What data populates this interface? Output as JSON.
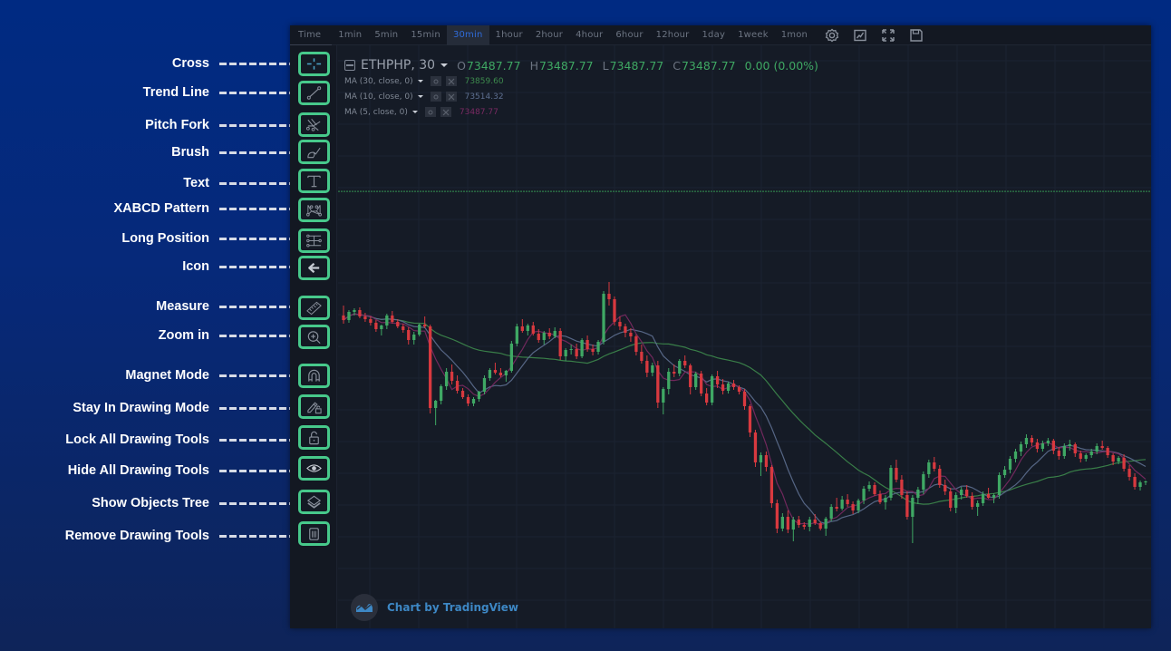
{
  "timeframes": [
    {
      "label": "Time",
      "active": false
    },
    {
      "label": "1min",
      "active": false
    },
    {
      "label": "5min",
      "active": false
    },
    {
      "label": "15min",
      "active": false
    },
    {
      "label": "30min",
      "active": true
    },
    {
      "label": "1hour",
      "active": false
    },
    {
      "label": "2hour",
      "active": false
    },
    {
      "label": "4hour",
      "active": false
    },
    {
      "label": "6hour",
      "active": false
    },
    {
      "label": "12hour",
      "active": false
    },
    {
      "label": "1day",
      "active": false
    },
    {
      "label": "1week",
      "active": false
    },
    {
      "label": "1mon",
      "active": false
    }
  ],
  "topbar_icons": [
    "settings-icon",
    "indicators-icon",
    "fullscreen-icon",
    "save-icon"
  ],
  "legend": {
    "symbol": "ETHPHP, 30",
    "open_label": "O",
    "open": "73487.77",
    "high_label": "H",
    "high": "73487.77",
    "low_label": "L",
    "low": "73487.77",
    "close_label": "C",
    "close": "73487.77",
    "change": "0.00 (0.00%)",
    "ma": [
      {
        "label": "MA (30, close, 0)",
        "value": "73859.60",
        "color": "#3d8a4d"
      },
      {
        "label": "MA (10, close, 0)",
        "value": "73514.32",
        "color": "#5d6f90"
      },
      {
        "label": "MA (5, close, 0)",
        "value": "73487.77",
        "color": "#7b2a63"
      }
    ]
  },
  "tools": [
    {
      "label": "Cross",
      "icon": "cross-icon"
    },
    {
      "label": "Trend Line",
      "icon": "trend-line-icon"
    },
    {
      "label": "Pitch Fork",
      "icon": "pitchfork-icon"
    },
    {
      "label": "Brush",
      "icon": "brush-icon"
    },
    {
      "label": "Text",
      "icon": "text-icon"
    },
    {
      "label": "XABCD Pattern",
      "icon": "xabcd-pattern-icon"
    },
    {
      "label": "Long Position",
      "icon": "long-position-icon"
    },
    {
      "label": "Icon",
      "icon": "arrow-left-icon"
    },
    {
      "label": "Measure",
      "icon": "ruler-icon"
    },
    {
      "label": "Zoom in",
      "icon": "zoom-in-icon"
    },
    {
      "label": "Magnet Mode",
      "icon": "magnet-icon"
    },
    {
      "label": "Stay In Drawing Mode",
      "icon": "pencil-lock-icon"
    },
    {
      "label": "Lock All Drawing Tools",
      "icon": "lock-icon"
    },
    {
      "label": "Hide All Drawing Tools",
      "icon": "eye-icon"
    },
    {
      "label": "Show Objects Tree",
      "icon": "layers-icon"
    },
    {
      "label": "Remove Drawing Tools",
      "icon": "trash-icon"
    }
  ],
  "watermark": "Chart by TradingView",
  "colors": {
    "up": "#3fa864",
    "down": "#d8393f",
    "highlight": "#47c98b",
    "active_tf": "#2f6bd9",
    "price_line": "#2e7d4a"
  },
  "chart_data": {
    "type": "candlestick",
    "symbol": "ETHPHP",
    "interval": "30min",
    "last_price": 73487.77,
    "ylim": [
      72530,
      73790
    ],
    "ohlc": [
      [
        73214,
        73236,
        73196,
        73204
      ],
      [
        73204,
        73226,
        73198,
        73222
      ],
      [
        73222,
        73230,
        73214,
        73226
      ],
      [
        73226,
        73232,
        73208,
        73212
      ],
      [
        73212,
        73220,
        73200,
        73206
      ],
      [
        73206,
        73212,
        73192,
        73198
      ],
      [
        73198,
        73204,
        73178,
        73184
      ],
      [
        73184,
        73194,
        73170,
        73192
      ],
      [
        73192,
        73218,
        73184,
        73214
      ],
      [
        73214,
        73224,
        73196,
        73200
      ],
      [
        73200,
        73206,
        73186,
        73190
      ],
      [
        73190,
        73196,
        73176,
        73182
      ],
      [
        73182,
        73188,
        73150,
        73160
      ],
      [
        73160,
        73178,
        73150,
        73172
      ],
      [
        73172,
        73196,
        73168,
        73194
      ],
      [
        73194,
        73212,
        73186,
        73190
      ],
      [
        73190,
        73194,
        72998,
        73010
      ],
      [
        73010,
        73028,
        72972,
        73026
      ],
      [
        73026,
        73062,
        73018,
        73058
      ],
      [
        73058,
        73098,
        73050,
        73090
      ],
      [
        73090,
        73106,
        73062,
        73070
      ],
      [
        73070,
        73082,
        73042,
        73048
      ],
      [
        73048,
        73054,
        73030,
        73034
      ],
      [
        73034,
        73040,
        73014,
        73020
      ],
      [
        73020,
        73034,
        73014,
        73030
      ],
      [
        73030,
        73048,
        73024,
        73046
      ],
      [
        73046,
        73082,
        73040,
        73076
      ],
      [
        73076,
        73098,
        73070,
        73094
      ],
      [
        73094,
        73110,
        73084,
        73088
      ],
      [
        73088,
        73098,
        73078,
        73082
      ],
      [
        73082,
        73094,
        73068,
        73092
      ],
      [
        73092,
        73158,
        73088,
        73152
      ],
      [
        73152,
        73196,
        73146,
        73190
      ],
      [
        73190,
        73206,
        73176,
        73180
      ],
      [
        73180,
        73196,
        73170,
        73192
      ],
      [
        73192,
        73200,
        73170,
        73174
      ],
      [
        73174,
        73184,
        73154,
        73160
      ],
      [
        73160,
        73180,
        73150,
        73176
      ],
      [
        73176,
        73186,
        73162,
        73168
      ],
      [
        73168,
        73188,
        73164,
        73180
      ],
      [
        73180,
        73186,
        73116,
        73124
      ],
      [
        73124,
        73142,
        73114,
        73138
      ],
      [
        73138,
        73150,
        73128,
        73140
      ],
      [
        73140,
        73152,
        73118,
        73124
      ],
      [
        73124,
        73164,
        73120,
        73160
      ],
      [
        73160,
        73170,
        73134,
        73140
      ],
      [
        73140,
        73150,
        73126,
        73134
      ],
      [
        73134,
        73160,
        73128,
        73156
      ],
      [
        73156,
        73268,
        73150,
        73262
      ],
      [
        73262,
        73288,
        73236,
        73250
      ],
      [
        73250,
        73256,
        73192,
        73200
      ],
      [
        73200,
        73212,
        73182,
        73190
      ],
      [
        73190,
        73196,
        73166,
        73176
      ],
      [
        73176,
        73186,
        73156,
        73168
      ],
      [
        73168,
        73172,
        73126,
        73134
      ],
      [
        73134,
        73150,
        73108,
        73114
      ],
      [
        73114,
        73126,
        73078,
        73088
      ],
      [
        73088,
        73110,
        73080,
        73104
      ],
      [
        73104,
        73114,
        73010,
        73022
      ],
      [
        73022,
        73056,
        72996,
        73052
      ],
      [
        73052,
        73098,
        73040,
        73090
      ],
      [
        73090,
        73106,
        73078,
        73086
      ],
      [
        73086,
        73118,
        73080,
        73114
      ],
      [
        73114,
        73126,
        73098,
        73104
      ],
      [
        73104,
        73108,
        73040,
        73056
      ],
      [
        73056,
        73090,
        73050,
        73086
      ],
      [
        73086,
        73092,
        73036,
        73042
      ],
      [
        73042,
        73054,
        73016,
        73022
      ],
      [
        73022,
        73084,
        73016,
        73080
      ],
      [
        73080,
        73092,
        73054,
        73062
      ],
      [
        73062,
        73074,
        73040,
        73048
      ],
      [
        73048,
        73068,
        73042,
        73064
      ],
      [
        73064,
        73072,
        73050,
        73056
      ],
      [
        73056,
        73060,
        73040,
        73046
      ],
      [
        73046,
        73052,
        73006,
        73014
      ],
      [
        73014,
        73018,
        72946,
        72956
      ],
      [
        72956,
        72962,
        72880,
        72890
      ],
      [
        72890,
        72912,
        72860,
        72906
      ],
      [
        72906,
        72914,
        72870,
        72880
      ],
      [
        72880,
        72884,
        72790,
        72800
      ],
      [
        72800,
        72808,
        72734,
        72744
      ],
      [
        72744,
        72778,
        72738,
        72770
      ],
      [
        72770,
        72784,
        72734,
        72742
      ],
      [
        72742,
        72770,
        72716,
        72764
      ],
      [
        72764,
        72772,
        72746,
        72752
      ],
      [
        72752,
        72758,
        72742,
        72748
      ],
      [
        72748,
        72770,
        72738,
        72764
      ],
      [
        72764,
        72776,
        72752,
        72756
      ],
      [
        72756,
        72760,
        72740,
        72744
      ],
      [
        72744,
        72770,
        72728,
        72766
      ],
      [
        72766,
        72798,
        72760,
        72792
      ],
      [
        72792,
        72812,
        72782,
        72788
      ],
      [
        72788,
        72816,
        72784,
        72808
      ],
      [
        72808,
        72820,
        72792,
        72798
      ],
      [
        72798,
        72804,
        72776,
        72784
      ],
      [
        72784,
        72810,
        72778,
        72806
      ],
      [
        72806,
        72838,
        72798,
        72832
      ],
      [
        72832,
        72848,
        72826,
        72840
      ],
      [
        72840,
        72846,
        72816,
        72820
      ],
      [
        72820,
        72828,
        72798,
        72802
      ],
      [
        72802,
        72818,
        72786,
        72812
      ],
      [
        72812,
        72884,
        72806,
        72878
      ],
      [
        72878,
        72896,
        72846,
        72852
      ],
      [
        72852,
        72862,
        72810,
        72818
      ],
      [
        72818,
        72826,
        72764,
        72770
      ],
      [
        72770,
        72818,
        72712,
        72812
      ],
      [
        72812,
        72836,
        72798,
        72830
      ],
      [
        72830,
        72870,
        72820,
        72864
      ],
      [
        72864,
        72896,
        72856,
        72890
      ],
      [
        72890,
        72902,
        72870,
        72876
      ],
      [
        72876,
        72884,
        72834,
        72840
      ],
      [
        72840,
        72852,
        72818,
        72826
      ],
      [
        72826,
        72834,
        72782,
        72790
      ],
      [
        72790,
        72824,
        72778,
        72818
      ],
      [
        72818,
        72836,
        72808,
        72830
      ],
      [
        72830,
        72840,
        72812,
        72816
      ],
      [
        72816,
        72824,
        72786,
        72792
      ],
      [
        72792,
        72806,
        72772,
        72800
      ],
      [
        72800,
        72826,
        72794,
        72820
      ],
      [
        72820,
        72834,
        72810,
        72812
      ],
      [
        72812,
        72822,
        72800,
        72818
      ],
      [
        72818,
        72868,
        72810,
        72862
      ],
      [
        72862,
        72882,
        72856,
        72874
      ],
      [
        72874,
        72904,
        72866,
        72898
      ],
      [
        72898,
        72920,
        72890,
        72914
      ],
      [
        72914,
        72936,
        72904,
        72930
      ],
      [
        72930,
        72952,
        72922,
        72944
      ],
      [
        72944,
        72950,
        72926,
        72934
      ],
      [
        72934,
        72942,
        72912,
        72920
      ],
      [
        72920,
        72938,
        72914,
        72932
      ],
      [
        72932,
        72944,
        72926,
        72938
      ],
      [
        72938,
        72942,
        72908,
        72916
      ],
      [
        72916,
        72924,
        72896,
        72904
      ],
      [
        72904,
        72932,
        72898,
        72926
      ],
      [
        72926,
        72940,
        72916,
        72930
      ],
      [
        72930,
        72934,
        72902,
        72910
      ],
      [
        72910,
        72916,
        72890,
        72898
      ],
      [
        72898,
        72910,
        72892,
        72906
      ],
      [
        72906,
        72920,
        72900,
        72914
      ],
      [
        72914,
        72932,
        72908,
        72926
      ],
      [
        72926,
        72938,
        72918,
        72922
      ],
      [
        72922,
        72926,
        72900,
        72906
      ],
      [
        72906,
        72910,
        72884,
        72892
      ],
      [
        72892,
        72904,
        72886,
        72900
      ],
      [
        72900,
        72908,
        72870,
        72876
      ],
      [
        72876,
        72884,
        72850,
        72858
      ],
      [
        72858,
        72866,
        72830,
        72836
      ],
      [
        72836,
        72850,
        72828,
        72846
      ],
      [
        72846,
        72850,
        72840,
        72848
      ]
    ],
    "ma_series": [
      "MA 30",
      "MA 10",
      "MA 5"
    ]
  }
}
